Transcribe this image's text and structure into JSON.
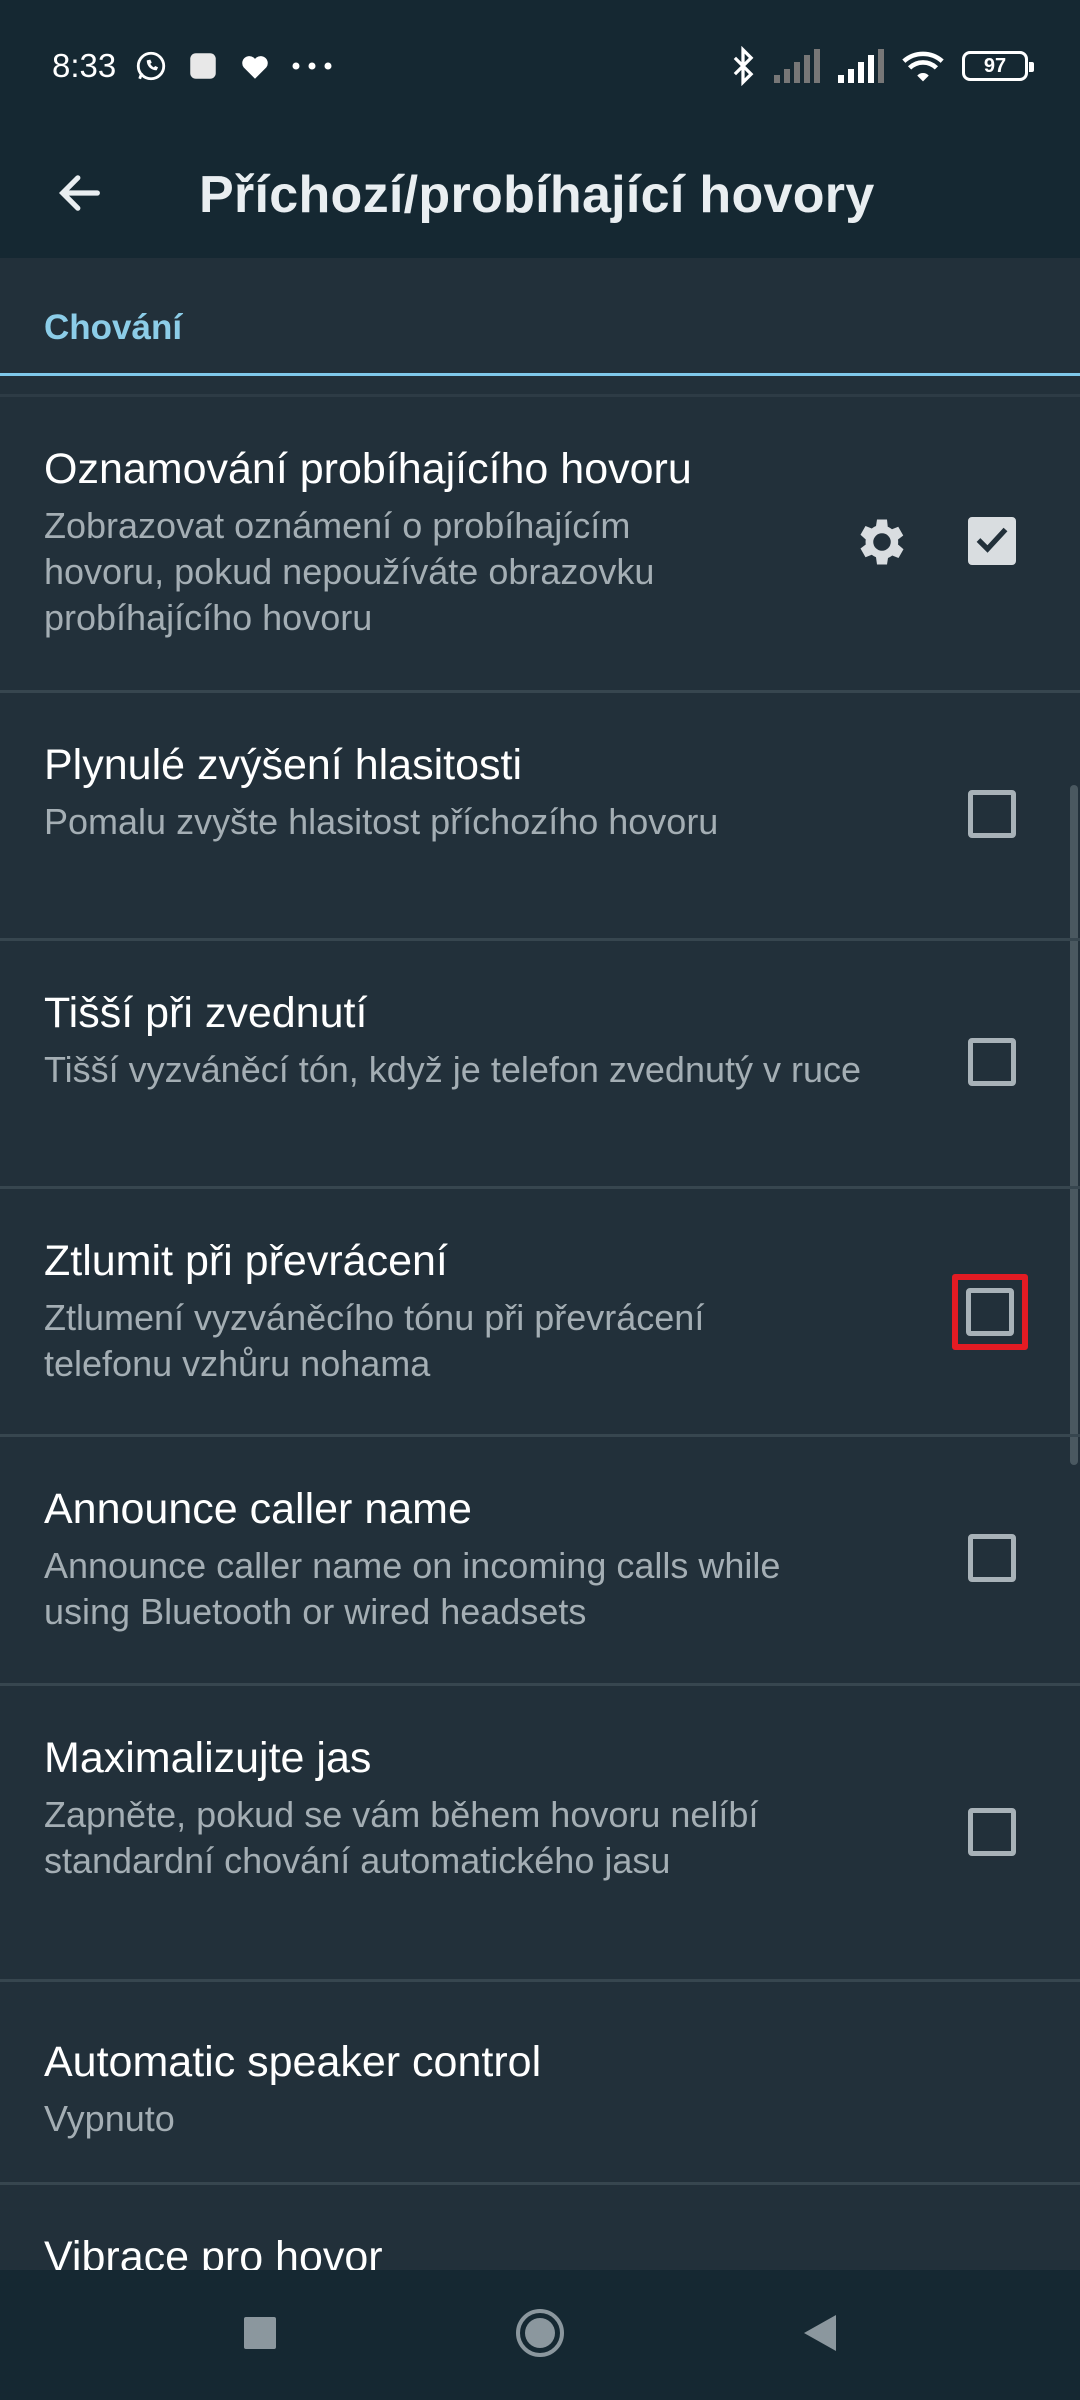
{
  "status_bar": {
    "time": "8:33",
    "left_icons": [
      "whatsapp-icon",
      "app-icon",
      "heart-icon",
      "more-dots-icon"
    ],
    "right_icons": [
      "bluetooth-icon",
      "signal-weak-icon",
      "signal-icon",
      "wifi-icon"
    ],
    "battery": "97"
  },
  "toolbar": {
    "title": "Příchozí/probíhající hovory",
    "back_icon": "arrow-left-icon"
  },
  "section": {
    "title": "Chování"
  },
  "items": [
    {
      "title": "Oznamování probíhajícího hovoru",
      "subtitle": "Zobrazovat oznámení o probíhajícím hovoru, pokud nepoužíváte obrazovku probíhajícího hovoru",
      "checked": true,
      "has_settings": true
    },
    {
      "title": "Plynulé zvýšení hlasitosti",
      "subtitle": "Pomalu zvyšte hlasitost příchozího hovoru",
      "checked": false
    },
    {
      "title": "Tišší při zvednutí",
      "subtitle": "Tišší vyzváněcí tón, když je telefon zvednutý v ruce",
      "checked": false
    },
    {
      "title": "Ztlumit při převrácení",
      "subtitle": "Ztlumení vyzváněcího tónu při převrácení telefonu vzhůru nohama",
      "checked": false,
      "highlighted": true
    },
    {
      "title": "Announce caller name",
      "subtitle": "Announce caller name on incoming calls while using Bluetooth or wired headsets",
      "checked": false
    },
    {
      "title": "Maximalizujte jas",
      "subtitle": "Zapněte, pokud se vám během hovoru nelíbí standardní chování automatického jasu",
      "checked": false
    },
    {
      "title": "Automatic speaker control",
      "subtitle": "Vypnuto"
    },
    {
      "title": "Vibrace pro hovor"
    }
  ],
  "nav_bar": {
    "recents_icon": "square-icon",
    "home_icon": "circle-icon",
    "back_icon": "triangle-back-icon"
  },
  "colors": {
    "background": "#22303a",
    "bar": "#152832",
    "accent": "#8ccde8",
    "highlight": "#e31b23"
  }
}
